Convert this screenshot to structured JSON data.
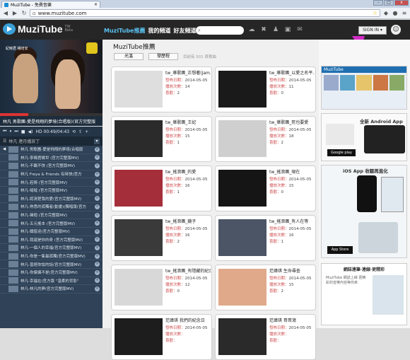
{
  "browser": {
    "tab_title": "MuziTube - 免費音樂",
    "url": "www.muzitube.com",
    "win_min": "-",
    "win_max": "□",
    "win_close": "x"
  },
  "site": {
    "logo": "MuziTube",
    "logo_tw": "TW",
    "logo_sub": "Beta",
    "nav": [
      "MuziTube推薦",
      "我的頻道",
      "好友頻道"
    ],
    "signin": "SIGN IN ▾",
    "accent": "#5bc0f0",
    "arrow_color": "#d12bc5"
  },
  "player": {
    "overlay_text": "紀曉君 楊培安",
    "now_playing": "林凡 男歌團-愛是飛翔的夢境(合唱版)(官方完整版",
    "time": "HD 00:49/04:43",
    "playlist_title": "林凡 連月播放丁",
    "playlist": [
      "林凡 男歌團-愛是飛翔的夢境(合唱版",
      "林凡-寧曉君曉世 (官方完整版MV)",
      "林凡-不羈不快 (官方完整版MV)",
      "林凡 Freya & Friends 有時快(官方",
      "林凡-若情 (官方完整版MV)",
      "林凡-噠噠 (官方完整版MV)",
      "林凡-認清楚我的愛(官方完整版MV)",
      "林凡-熟悉的孤獨者(動畫)(獨唱版(官方",
      "林凡-擁抱 (官方完整版MV)",
      "林凡-五元搖本 (官方完整版MV)",
      "林凡-鐵窗迎(官方完整版MV)",
      "林凡-我還是你的奇 (官方完整版MV)",
      "林凡-一個人的幸福(官方完整版MV)",
      "林凡-你是一隻最孤獨(官方完整版MV)",
      "林凡-曾經你說的話(官方完整版MV)",
      "林凡-你偏偏不是(官方完整版MV)",
      "林凡-幸福在(官方版 \"溫柔的背影\"",
      "林凡-林凡的夢(官方完整版MV)"
    ]
  },
  "main": {
    "title": "MuziTube推薦",
    "sort_buttons": [
      "光溫",
      "發歷程"
    ],
    "count_text": "目前有 501 首歌曲",
    "field_date": "發佈日期：",
    "field_views": "播放次數：",
    "field_likes": "喜歡：",
    "cards": [
      {
        "title": "tw_華歌團_正想著(Jam...",
        "date": "2014-05-05",
        "views": "14",
        "likes": "2",
        "thumb": "#dedede"
      },
      {
        "title": "tw_華歌團_以愛之名平...",
        "date": "2014-05-05",
        "views": "11",
        "likes": "0",
        "thumb": "#1a1a1a"
      },
      {
        "title": "tw_華歌團_王妃",
        "date": "2014-05-05",
        "views": "15",
        "likes": "1",
        "thumb": "#2b2b2b"
      },
      {
        "title": "tw_華歌團_死也要愛",
        "date": "2014-05-05",
        "views": "18",
        "likes": "2",
        "thumb": "#cfcfcf"
      },
      {
        "title": "tw_搖滾團_的愛",
        "date": "2014-05-05",
        "views": "16",
        "likes": "1",
        "thumb": "#a42f3a"
      },
      {
        "title": "tw_搖滾團_現在",
        "date": "2014-05-05",
        "views": "15",
        "likes": "0",
        "thumb": "#151515"
      },
      {
        "title": "tw_搖滾團_鏡子",
        "date": "2014-05-05",
        "views": "16",
        "likes": "2",
        "thumb": "#3a3a3a"
      },
      {
        "title": "tw_搖滾團_有人在等",
        "date": "2014-05-05",
        "views": "16",
        "likes": "1",
        "thumb": "#4b5566"
      },
      {
        "title": "tw_搖滾團_有隱藏的紀念日",
        "date": "2014-05-05",
        "views": "12",
        "likes": "0",
        "thumb": "#d8d8d8"
      },
      {
        "title": "范瑋琪 生命尋查",
        "date": "2014-05-05",
        "views": "15",
        "likes": "2",
        "thumb": "#e0a98a"
      },
      {
        "title": "范瑋琪 我們的紀念日",
        "date": "2014-05-05",
        "views": "",
        "likes": "",
        "thumb": "#1d1d1d"
      },
      {
        "title": "范瑋琪 哥哥瀉",
        "date": "2014-05-05",
        "views": "",
        "likes": "",
        "thumb": "#2a2a2a"
      }
    ]
  },
  "ads": {
    "banner_label": "MuziTube",
    "android_title": "全新 Android App",
    "google_play": "Google play",
    "ios_title": "iOS App 收聽再進化",
    "appstore": "App Store",
    "news_title": "網誌連筆‧連線‧更精彩",
    "news_text": "MuziTube 網誌上線 更精彩的音樂內容等你來"
  }
}
